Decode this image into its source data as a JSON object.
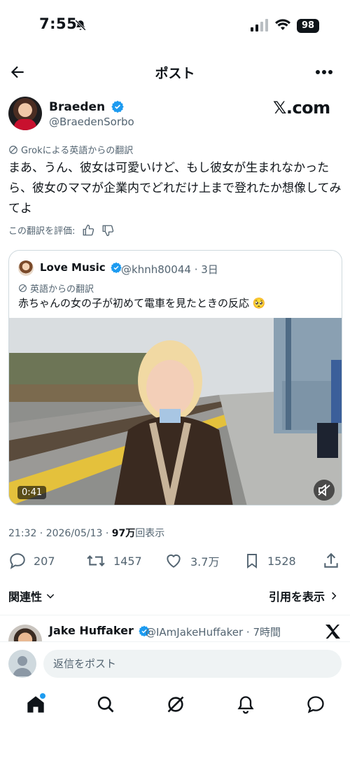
{
  "status_bar": {
    "time": "7:55",
    "battery": "98"
  },
  "header": {
    "title": "ポスト"
  },
  "author": {
    "name": "Braeden",
    "handle": "@BraedenSorbo"
  },
  "watermark": "𝕏.com",
  "translation": {
    "label": "Grokによる英語からの翻訳",
    "text": "まあ、うん、彼女は可愛いけど、もし彼女が生まれなかったら、彼女のママが企業内でどれだけ上まで登れたか想像してみてよ",
    "rate_label": "この翻訳を評価:"
  },
  "quote": {
    "name": "Love Music",
    "handle_time": "@khnh80044 · 3日",
    "translation_label": "英語からの翻訳",
    "text": "赤ちゃんの女の子が初めて電車を見たときの反応 🥺",
    "duration": "0:41"
  },
  "meta": {
    "time_date": "21:32 · 2026/05/13 · ",
    "views_count": "97万",
    "views_label": "回表示"
  },
  "actions": {
    "replies": "207",
    "reposts": "1457",
    "likes": "3.7万",
    "bookmarks": "1528"
  },
  "sort": {
    "label": "関連性",
    "quotes_link": "引用を表示"
  },
  "reply_preview": {
    "name": "Jake Huffaker",
    "handle_time": "@IAmJakeHuffaker · 7時間"
  },
  "reply_bar": {
    "placeholder": "返信をポスト"
  },
  "colors": {
    "accent": "#1d9bf0",
    "text": "#0f1419",
    "secondary": "#536471"
  }
}
